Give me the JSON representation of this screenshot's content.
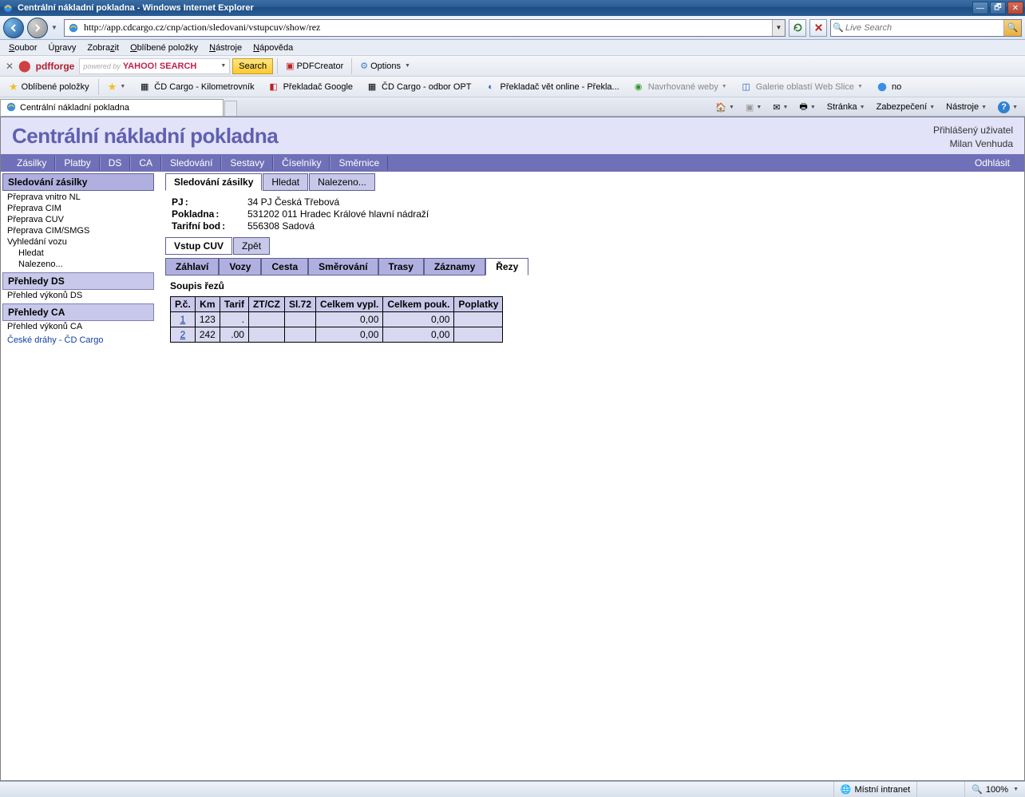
{
  "window": {
    "title": "Centrální nákladní pokladna - Windows Internet Explorer",
    "url": "http://app.cdcargo.cz/cnp/action/sledovani/vstupcuv/show/rez",
    "search_placeholder": "Live Search"
  },
  "menu": [
    "Soubor",
    "Úpravy",
    "Zobrazit",
    "Oblíbené položky",
    "Nástroje",
    "Nápověda"
  ],
  "menu_u": [
    "S",
    "p",
    "z",
    "O",
    "N",
    "N"
  ],
  "toolbar1": {
    "pdfforge": "pdfforge",
    "yahoo": "YAHOO! SEARCH",
    "powered": "powered by",
    "search": "Search",
    "pdfcreator": "PDFCreator",
    "options": "Options"
  },
  "favbar": {
    "fav": "Oblíbené položky",
    "items": [
      "ČD Cargo - Kilometrovník",
      "Překladač Google",
      "ČD Cargo - odbor OPT",
      "Překladač vět online - Překla...",
      "Navrhované weby",
      "Galerie oblastí Web Slice",
      "no"
    ]
  },
  "pagetab": "Centrální nákladní pokladna",
  "righttools": [
    "Stránka",
    "Zabezpečení",
    "Nástroje"
  ],
  "app": {
    "title": "Centrální nákladní pokladna",
    "user_label": "Přihlášený uživatel",
    "user_name": "Milan Venhuda",
    "logout": "Odhlásit",
    "nav": [
      "Zásilky",
      "Platby",
      "DS",
      "CA",
      "Sledování",
      "Sestavy",
      "Číselníky",
      "Směrnice"
    ]
  },
  "sidebar": {
    "h1": "Sledování zásilky",
    "links1": [
      "Přeprava vnitro NL",
      "Přeprava CIM",
      "Přeprava CUV",
      "Přeprava CIM/SMGS",
      "Vyhledání vozu"
    ],
    "sub1": [
      "Hledat",
      "Nalezeno..."
    ],
    "h2": "Přehledy DS",
    "links2": [
      "Přehled výkonů DS"
    ],
    "h3": "Přehledy CA",
    "links3": [
      "Přehled výkonů CA"
    ],
    "foot1": "České dráhy",
    "foot_sep": " - ",
    "foot2": "ČD Cargo"
  },
  "mtabs": {
    "t1": "Sledování zásilky",
    "t2": "Hledat",
    "t3": "Nalezeno..."
  },
  "info": {
    "pj_l": "PJ",
    "pj_v": "34 PJ Česká Třebová",
    "pok_l": "Pokladna",
    "pok_v": "531202 011 Hradec Králové hlavní nádraží",
    "tb_l": "Tarifní bod",
    "tb_v": "556308 Sadová"
  },
  "stabs": {
    "t1": "Vstup CUV",
    "t2": "Zpět"
  },
  "itabs": [
    "Záhlaví",
    "Vozy",
    "Cesta",
    "Směrování",
    "Trasy",
    "Záznamy",
    "Řezy"
  ],
  "itabs_active": 6,
  "section": "Soupis řezů",
  "table": {
    "headers": [
      "P.č.",
      "Km",
      "Tarif",
      "ZT/CZ",
      "Sl.72",
      "Celkem vypl.",
      "Celkem pouk.",
      "Poplatky"
    ],
    "rows": [
      {
        "pc": "1",
        "km": "123",
        "tarif": ".",
        "zt": "",
        "sl": "",
        "vypl": "0,00",
        "pouk": "0,00",
        "pop": ""
      },
      {
        "pc": "2",
        "km": "242",
        "tarif": ".00",
        "zt": "",
        "sl": "",
        "vypl": "0,00",
        "pouk": "0,00",
        "pop": ""
      }
    ]
  },
  "status": {
    "zone": "Místní intranet",
    "zoom": "100%"
  }
}
